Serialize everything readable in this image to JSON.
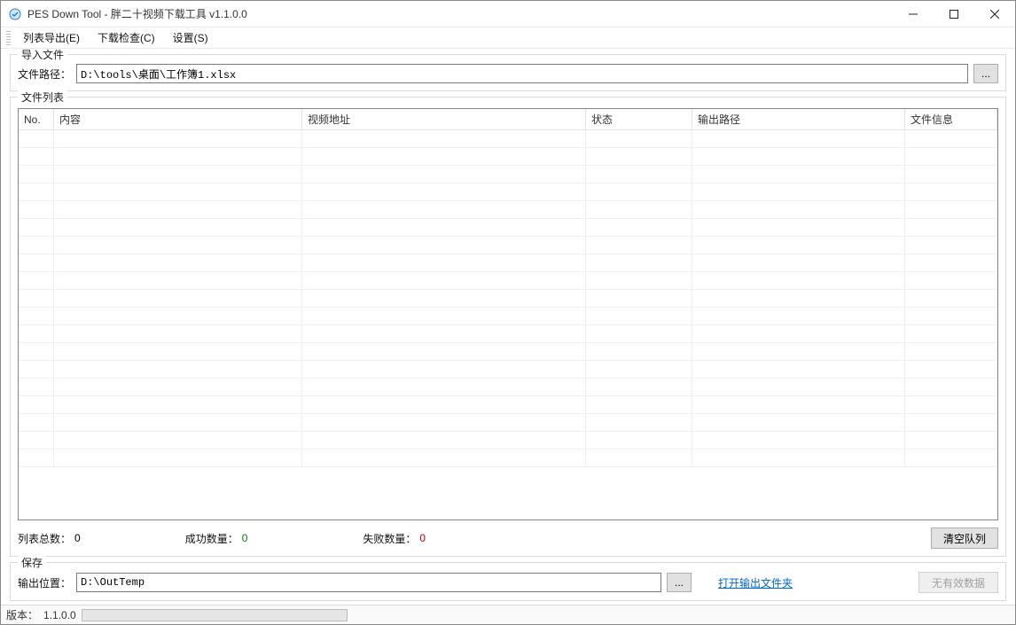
{
  "window": {
    "title": "PES Down Tool - 胖二十视频下载工具 v1.1.0.0"
  },
  "menu": {
    "export": "列表导出(E)",
    "check": "下载检查(C)",
    "settings": "设置(S)"
  },
  "import_group": {
    "legend": "导入文件",
    "path_label": "文件路径：",
    "path_value": "D:\\tools\\桌面\\工作簿1.xlsx",
    "browse_label": "..."
  },
  "filelist_group": {
    "legend": "文件列表",
    "columns": {
      "no": "No.",
      "content": "内容",
      "url": "视频地址",
      "status": "状态",
      "outpath": "输出路径",
      "info": "文件信息"
    },
    "rows": []
  },
  "stats": {
    "total_label": "列表总数：",
    "total_value": "0",
    "ok_label": "成功数量：",
    "ok_value": "0",
    "fail_label": "失败数量：",
    "fail_value": "0",
    "clear_label": "清空队列"
  },
  "save_group": {
    "legend": "保存",
    "out_label": "输出位置：",
    "out_value": "D:\\OutTemp",
    "browse_label": "...",
    "open_folder_link": "打开输出文件夹",
    "nodata_btn": "无有效数据"
  },
  "statusbar": {
    "version_label": "版本：",
    "version_value": "1.1.0.0"
  }
}
